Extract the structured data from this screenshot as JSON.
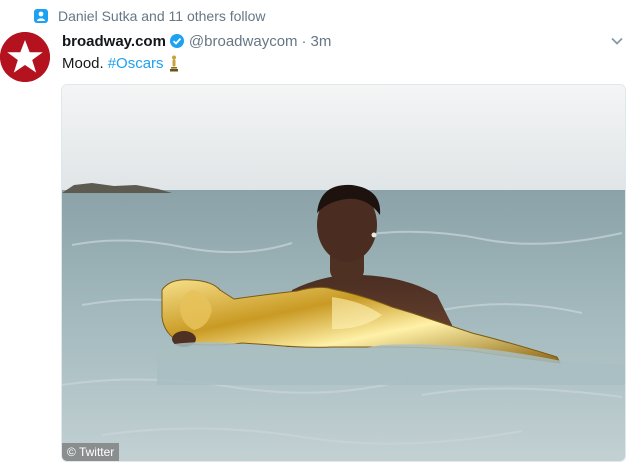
{
  "social_context": {
    "text": "Daniel Sutka and 11 others follow",
    "icon": "person-icon",
    "icon_color": "#1da1f2"
  },
  "tweet": {
    "display_name": "broadway.com",
    "verified": true,
    "handle": "@broadwaycom",
    "separator": "·",
    "time": "3m",
    "text": "Mood.",
    "hashtag": "#Oscars",
    "emoji": "trophy-icon",
    "avatar_color": "#b3121e",
    "accent": "#1da1f2"
  },
  "media": {
    "alt": "Man swimming in the sea holding a large golden Oscar statue",
    "credit": "© Twitter"
  }
}
